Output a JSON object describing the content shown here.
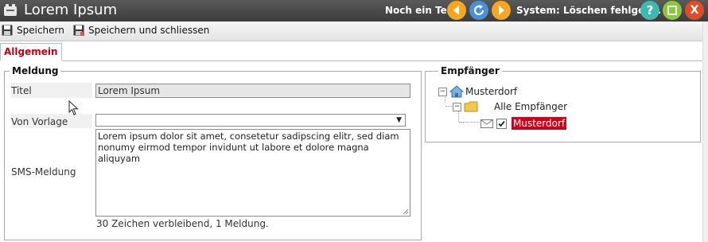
{
  "window": {
    "title": "Lorem Ipsum",
    "status_test": "Noch ein Test",
    "status_system": "System: Löschen fehlges...",
    "icons": {
      "app": "app-window-icon",
      "back": "back-arrow-icon",
      "refresh": "refresh-icon",
      "forward": "forward-arrow-icon",
      "help": "help-icon",
      "maximize": "maximize-icon",
      "close": "close-icon"
    },
    "close_label": "X",
    "colors": {
      "titlebar": "#474747",
      "nav_orange": "#f5a623",
      "nav_blue": "#4a90d9",
      "help_teal": "#3fb8b0",
      "max_green": "#8dc63f",
      "close_red": "#e14b2a",
      "accent_red": "#c40010"
    }
  },
  "toolbar": {
    "save_label": "Speichern",
    "save_close_label": "Speichern und schliessen"
  },
  "tabs": [
    {
      "label": "Allgemein",
      "active": true
    }
  ],
  "meldung": {
    "legend": "Meldung",
    "title_label": "Titel",
    "title_value": "Lorem Ipsum",
    "vorlage_label": "Von Vorlage",
    "vorlage_value": "",
    "sms_label": "SMS-Meldung",
    "sms_value": "Lorem ipsum dolor sit amet, consetetur sadipscing elitr, sed diam nonumy eirmod tempor invidunt ut labore et dolore magna aliquyam",
    "counter": "30 Zeichen verbleibend, 1 Meldung."
  },
  "empfaenger": {
    "legend": "Empfänger",
    "root": "Musterdorf",
    "group": "Alle Empfänger",
    "item": "Musterdorf",
    "item_checked": true
  }
}
